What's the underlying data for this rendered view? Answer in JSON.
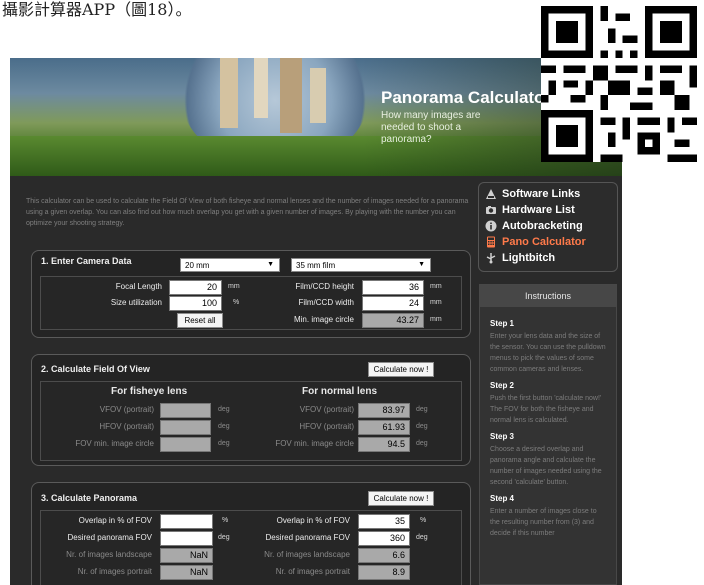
{
  "caption": "攝影計算器APP（圖18）。",
  "banner": {
    "title": "Panorama Calculator",
    "subtitle": "How many images are needed to shoot a panorama?"
  },
  "intro": "This calculator can be used to calculate the Field Of View of both fisheye and normal lenses and the number of images needed for a panorama using a given overlap. You can also find out how much overlap you get with a given number of images. By playing with the number you can optimize your shooting strategy.",
  "nav": {
    "items": [
      {
        "label": "Software Links",
        "icon": "software-icon"
      },
      {
        "label": "Hardware List",
        "icon": "camera-icon"
      },
      {
        "label": "Autobracketing",
        "icon": "info-icon"
      },
      {
        "label": "Pano Calculator",
        "icon": "calculator-icon"
      },
      {
        "label": "Lightbitch",
        "icon": "light-icon"
      }
    ],
    "active_color": "#ff7a4a"
  },
  "instructions": {
    "header": "Instructions",
    "steps": [
      {
        "title": "Step 1",
        "text": "Enter your lens data and the size of the sensor. You can use the pulldown menus to pick the values of some common cameras and lenses."
      },
      {
        "title": "Step 2",
        "text": "Push the first button 'calculate now!' The FOV for both the fisheye and normal lens is calculated."
      },
      {
        "title": "Step 3",
        "text": "Choose a desired overlap and panorama angle and calculate the number of images needed using the second 'calculate' button."
      },
      {
        "title": "Step 4",
        "text": "Enter a number of images close to the resulting number from (3) and decide if this number"
      }
    ]
  },
  "section1": {
    "title": "1. Enter Camera Data",
    "lens_select": "20 mm",
    "film_select": "35 mm film",
    "focal_length": {
      "label": "Focal Length",
      "value": "20",
      "unit": "mm"
    },
    "size_utilization": {
      "label": "Size utilization",
      "value": "100",
      "unit": "%"
    },
    "reset_label": "Reset all",
    "film_height": {
      "label": "Film/CCD height",
      "value": "36",
      "unit": "mm"
    },
    "film_width": {
      "label": "Film/CCD width",
      "value": "24",
      "unit": "mm"
    },
    "min_circle": {
      "label": "Min. image circle",
      "value": "43.27",
      "unit": "mm"
    }
  },
  "section2": {
    "title": "2. Calculate Field Of View",
    "button": "Calculate now !",
    "fisheye": {
      "header": "For fisheye lens",
      "vfov": {
        "label": "VFOV (portrait)",
        "value": "",
        "unit": "deg"
      },
      "hfov": {
        "label": "HFOV (portrait)",
        "value": "",
        "unit": "deg"
      },
      "circle": {
        "label": "FOV min. image circle",
        "value": "",
        "unit": "deg"
      }
    },
    "normal": {
      "header": "For normal lens",
      "vfov": {
        "label": "VFOV (portrait)",
        "value": "83.97",
        "unit": "deg"
      },
      "hfov": {
        "label": "HFOV (portrait)",
        "value": "61.93",
        "unit": "deg"
      },
      "circle": {
        "label": "FOV min. image circle",
        "value": "94.5",
        "unit": "deg"
      }
    }
  },
  "section3": {
    "title": "3. Calculate Panorama",
    "button": "Calculate now !",
    "left": {
      "overlap": {
        "label": "Overlap in % of FOV",
        "value": "",
        "unit": "%"
      },
      "pano_fov": {
        "label": "Desired panorama FOV",
        "value": "",
        "unit": "deg"
      },
      "landscape": {
        "label": "Nr. of images landscape",
        "value": "NaN"
      },
      "portrait": {
        "label": "Nr. of images portrait",
        "value": "NaN"
      }
    },
    "right": {
      "overlap": {
        "label": "Overlap in % of FOV",
        "value": "35",
        "unit": "%"
      },
      "pano_fov": {
        "label": "Desired panorama FOV",
        "value": "360",
        "unit": "deg"
      },
      "landscape": {
        "label": "Nr. of images landscape",
        "value": "6.6"
      },
      "portrait": {
        "label": "Nr. of images portrait",
        "value": "8.9"
      }
    }
  }
}
